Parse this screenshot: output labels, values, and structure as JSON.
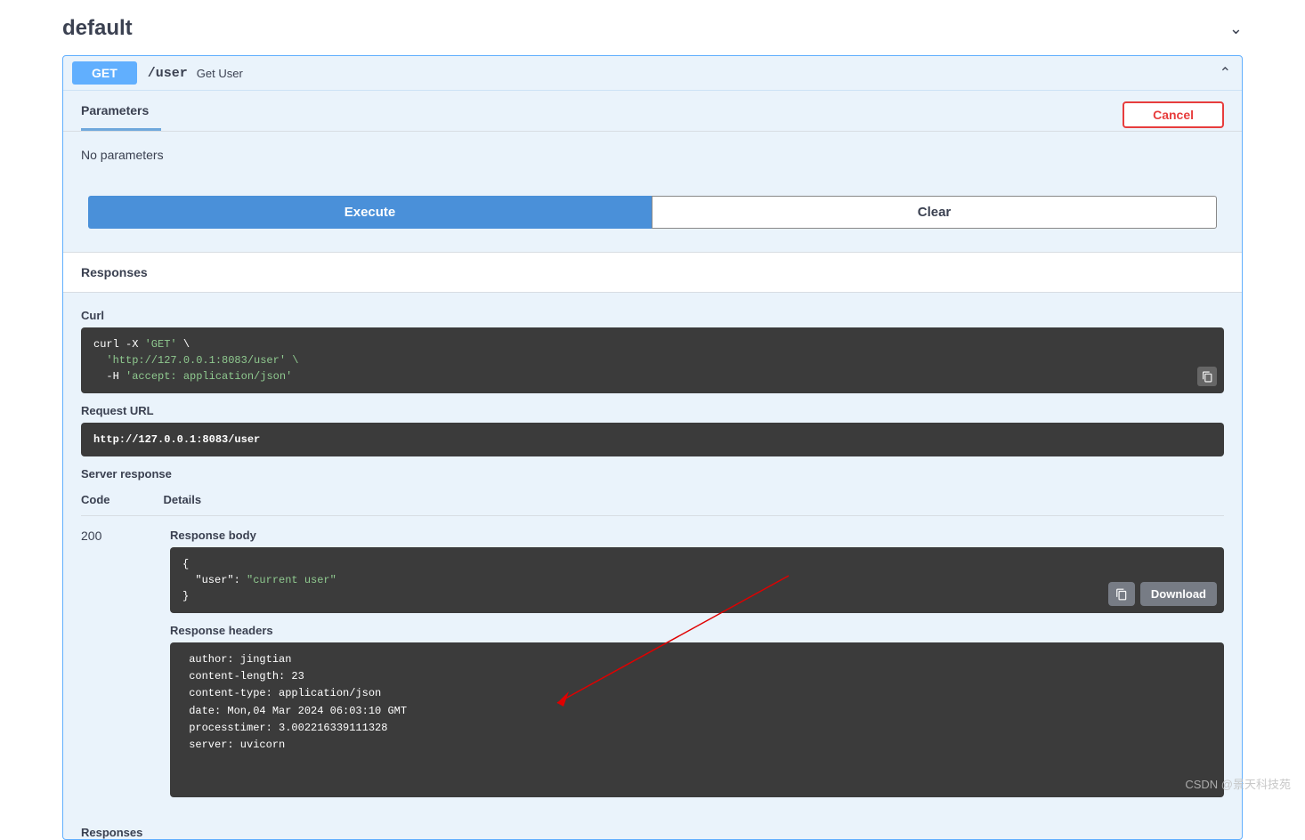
{
  "section": {
    "name": "default"
  },
  "op": {
    "method": "GET",
    "path": "/user",
    "summary": "Get User"
  },
  "tabs": {
    "parameters": "Parameters"
  },
  "buttons": {
    "cancel": "Cancel",
    "execute": "Execute",
    "clear": "Clear",
    "download": "Download"
  },
  "labels": {
    "no_parameters": "No parameters",
    "responses": "Responses",
    "curl": "Curl",
    "request_url": "Request URL",
    "server_response": "Server response",
    "code": "Code",
    "details": "Details",
    "response_body": "Response body",
    "response_headers": "Response headers",
    "responses_footer": "Responses"
  },
  "curl": {
    "l1": "curl -X ",
    "l1b": "'GET'",
    "l1c": " \\",
    "l2": "  'http://127.0.0.1:8083/user' \\",
    "l3a": "  -H ",
    "l3b": "'accept: application/json'"
  },
  "request_url": "http://127.0.0.1:8083/user",
  "response": {
    "code": "200",
    "body_open": "{",
    "body_key": "  \"user\"",
    "body_sep": ": ",
    "body_val": "\"current user\"",
    "body_close": "}",
    "headers": " author: jingtian\n content-length: 23\n content-type: application/json\n date: Mon,04 Mar 2024 06:03:10 GMT\n processtimer: 3.002216339111328\n server: uvicorn"
  },
  "watermark": "CSDN @景天科技苑"
}
